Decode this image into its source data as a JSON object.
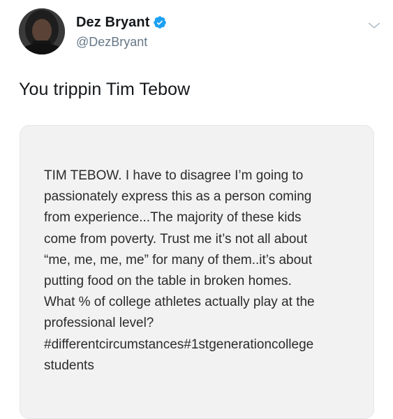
{
  "tweet": {
    "author": {
      "display_name": "Dez Bryant",
      "handle": "@DezBryant",
      "verified": true
    },
    "text": "You trippin Tim Tebow",
    "media": {
      "text": "TIM TEBOW. I have to disagree I’m going to\npassionately express this as a person coming\nfrom experience...The majority of these kids\ncome from poverty. Trust me it’s not all about\n“me, me, me, me” for many of them..it’s about\nputting food on the table in broken homes.\nWhat % of college athletes actually play at the\nprofessional level?\n#differentcircumstances#1stgenerationcollege\nstudents"
    }
  },
  "icons": {
    "verified": "verified-badge-icon",
    "menu": "chevron-down-icon"
  },
  "colors": {
    "verified_blue": "#1da1f2",
    "handle_gray": "#657786",
    "media_background": "#f2f2f3"
  }
}
